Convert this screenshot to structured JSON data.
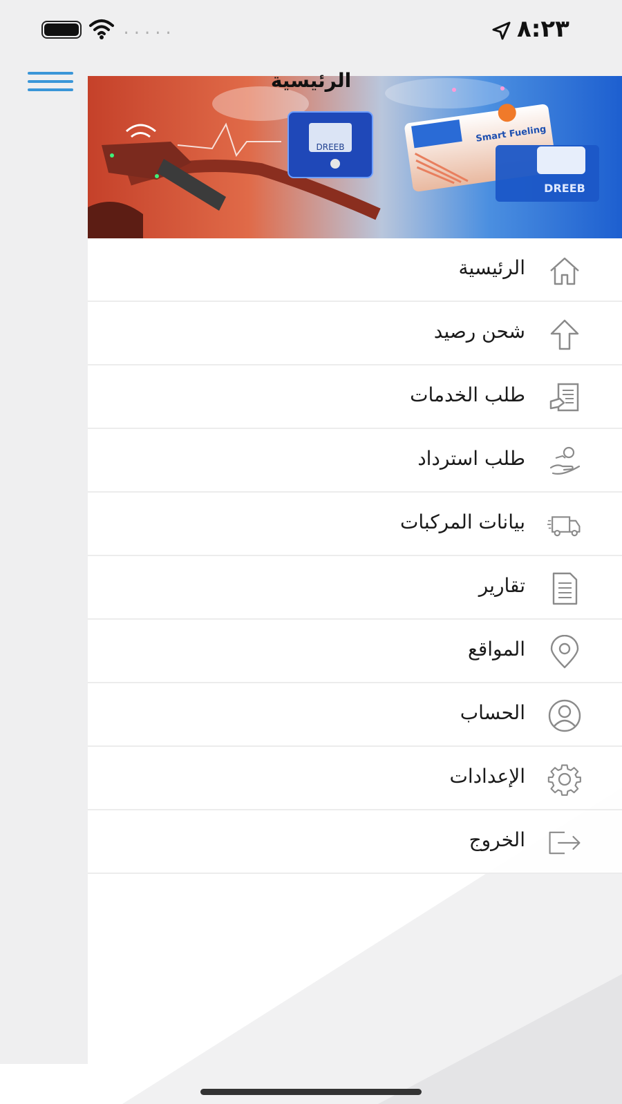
{
  "status_bar": {
    "time": "٨:٢٣",
    "signal_dots": "....."
  },
  "header": {
    "title": "الرئيسية"
  },
  "banner": {
    "card_text": "Smart Fueling",
    "brand_text": "DREEB"
  },
  "menu": {
    "items": [
      {
        "label": "الرئيسية",
        "icon": "home-icon"
      },
      {
        "label": "شحن رصيد",
        "icon": "arrow-up-icon"
      },
      {
        "label": "طلب الخدمات",
        "icon": "service-request-icon"
      },
      {
        "label": "طلب استرداد",
        "icon": "refund-hand-icon"
      },
      {
        "label": "بيانات المركبات",
        "icon": "truck-icon"
      },
      {
        "label": "تقارير",
        "icon": "report-icon"
      },
      {
        "label": "المواقع",
        "icon": "location-pin-icon"
      },
      {
        "label": "الحساب",
        "icon": "account-icon"
      },
      {
        "label": "الإعدادات",
        "icon": "gear-icon"
      },
      {
        "label": "الخروج",
        "icon": "logout-icon"
      }
    ]
  },
  "colors": {
    "accent": "#3a96d8",
    "icon_gray": "#8a8a8a",
    "background": "#efeff0"
  }
}
